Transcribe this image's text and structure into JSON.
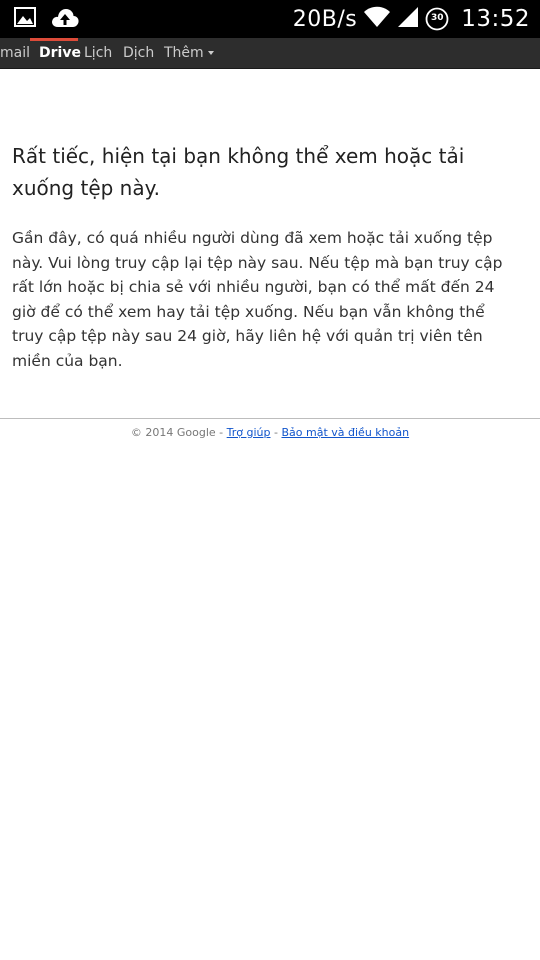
{
  "status_bar": {
    "net_speed": "20B/s",
    "battery_level": "30",
    "time": "13:52",
    "icons": [
      "image-icon",
      "cloud-upload-icon",
      "wifi-icon",
      "signal-icon",
      "battery-icon"
    ]
  },
  "nav": {
    "items": [
      "mail",
      "Drive",
      "Lịch",
      "Dịch",
      "Thêm"
    ],
    "active": "Drive",
    "accent_color": "#dd4b39"
  },
  "message": {
    "title": "Rất tiếc, hiện tại bạn không thể xem hoặc tải xuống tệp này.",
    "body": "Gần đây, có quá nhiều người dùng đã xem hoặc tải xuống tệp này. Vui lòng truy cập lại tệp này sau. Nếu tệp mà bạn truy cập rất lớn hoặc bị chia sẻ với nhiều người, bạn có thể mất đến 24 giờ để có thể xem hay tải tệp xuống. Nếu bạn vẫn không thể truy cập tệp này sau 24 giờ, hãy liên hệ với quản trị viên tên miền của bạn."
  },
  "footer": {
    "copyright": "© 2014 Google",
    "separator": " - ",
    "help_link": "Trợ giúp",
    "privacy_link": "Bảo mật và điều khoản"
  }
}
